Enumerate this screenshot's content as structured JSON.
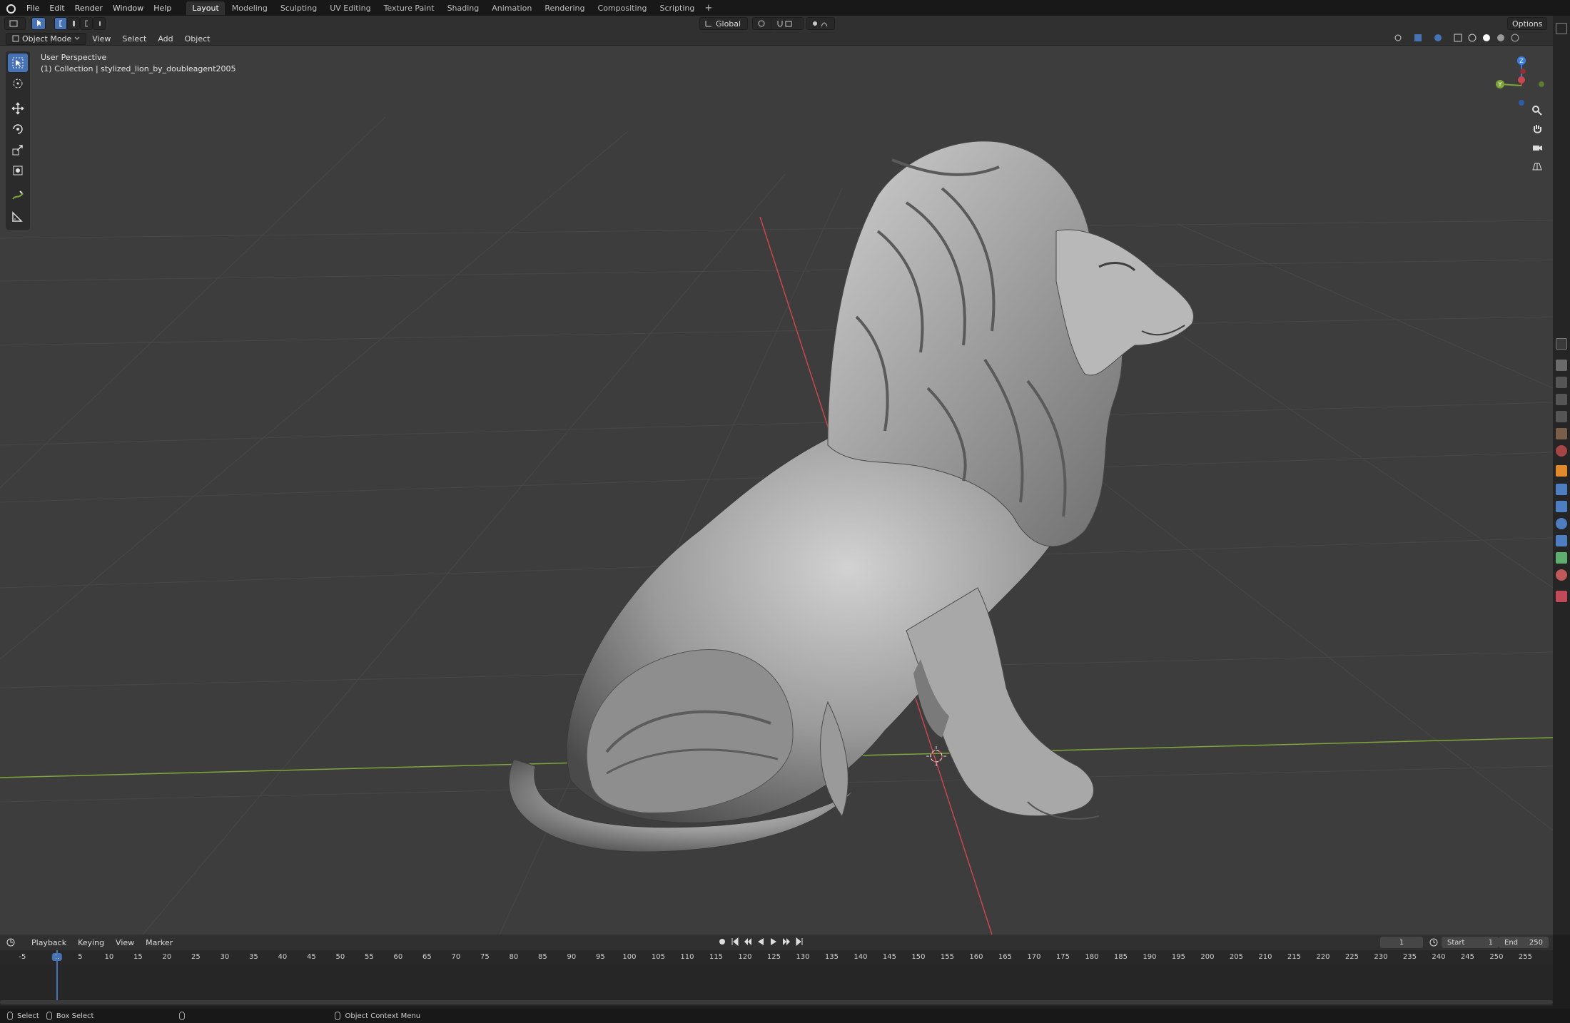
{
  "topbar": {
    "menus": [
      "File",
      "Edit",
      "Render",
      "Window",
      "Help"
    ],
    "workspaces": [
      "Layout",
      "Modeling",
      "Sculpting",
      "UV Editing",
      "Texture Paint",
      "Shading",
      "Animation",
      "Rendering",
      "Compositing",
      "Scripting"
    ],
    "active_workspace": "Layout",
    "add_workspace": "+"
  },
  "header": {
    "orientation": "Global",
    "options": "Options",
    "mode": "Object Mode",
    "menus": [
      "View",
      "Select",
      "Add",
      "Object"
    ]
  },
  "viewport": {
    "perspective_label": "User Perspective",
    "collection_label": "(1) Collection | stylized_lion_by_doubleagent2005"
  },
  "gizmo": {
    "x": "X",
    "y": "Y",
    "z": "Z"
  },
  "timeline": {
    "menus": [
      "Playback",
      "Keying",
      "View",
      "Marker"
    ],
    "current_frame": "1",
    "start_label": "Start",
    "start_value": "1",
    "end_label": "End",
    "end_value": "250",
    "ticks": [
      "-5",
      "1",
      "5",
      "10",
      "15",
      "20",
      "25",
      "30",
      "35",
      "40",
      "45",
      "50",
      "55",
      "60",
      "65",
      "70",
      "75",
      "80",
      "85",
      "90",
      "95",
      "100",
      "105",
      "110",
      "115",
      "120",
      "125",
      "130",
      "135",
      "140",
      "145",
      "150",
      "155",
      "160",
      "165",
      "170",
      "175",
      "180",
      "185",
      "190",
      "195",
      "200",
      "205",
      "210",
      "215",
      "220",
      "225",
      "230",
      "235",
      "240",
      "245",
      "250",
      "255"
    ]
  },
  "status": {
    "select": "Select",
    "box_select": "Box Select",
    "context_menu": "Object Context Menu"
  },
  "colors": {
    "accent": "#4772b3",
    "x_axis": "#c8474e",
    "y_axis": "#7ea63a",
    "z_axis": "#3b7ee0",
    "viewport_bg": "#3d3d3d"
  }
}
